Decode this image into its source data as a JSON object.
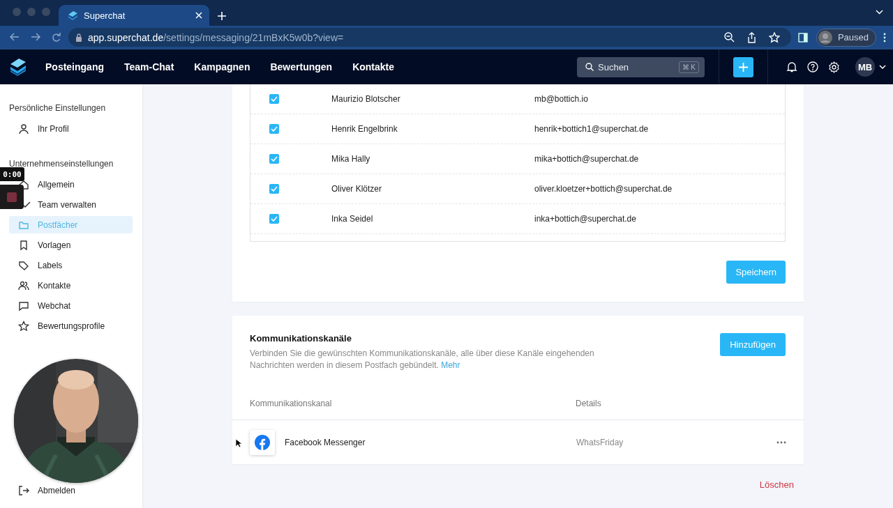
{
  "browser": {
    "tab_title": "Superchat",
    "url_host": "app.superchat.de",
    "url_path": "/settings/messaging/21mBxK5w0b?view=",
    "profile_status": "Paused"
  },
  "nav": {
    "items": [
      {
        "label": "Posteingang"
      },
      {
        "label": "Team-Chat"
      },
      {
        "label": "Kampagnen"
      },
      {
        "label": "Bewertungen"
      },
      {
        "label": "Kontakte"
      }
    ],
    "search": {
      "placeholder": "Suchen",
      "shortcut": "⌘ K"
    },
    "avatar": "MB"
  },
  "recording": {
    "time": "0:00"
  },
  "sidebar": {
    "sections": [
      {
        "title": "Persönliche Einstellungen",
        "items": [
          {
            "label": "Ihr Profil",
            "selected": false
          }
        ]
      },
      {
        "title": "Unternehmenseinstellungen",
        "items": [
          {
            "label": "Allgemein",
            "selected": false
          },
          {
            "label": "Team verwalten",
            "selected": false
          },
          {
            "label": "Postfächer",
            "selected": true
          },
          {
            "label": "Vorlagen",
            "selected": false
          },
          {
            "label": "Labels",
            "selected": false
          },
          {
            "label": "Kontakte",
            "selected": false
          },
          {
            "label": "Webchat",
            "selected": false
          },
          {
            "label": "Bewertungsprofile",
            "selected": false
          }
        ]
      }
    ],
    "logout": "Abmelden"
  },
  "members": {
    "rows": [
      {
        "name": "Maurizio Blotscher",
        "email": "mb@bottich.io",
        "checked": true
      },
      {
        "name": "Henrik Engelbrink",
        "email": "henrik+bottich1@superchat.de",
        "checked": true
      },
      {
        "name": "Mika Hally",
        "email": "mika+bottich@superchat.de",
        "checked": true
      },
      {
        "name": "Oliver Klötzer",
        "email": "oliver.kloetzer+bottich@superchat.de",
        "checked": true
      },
      {
        "name": "Inka Seidel",
        "email": "inka+bottich@superchat.de",
        "checked": true
      }
    ],
    "save_button": "Speichern"
  },
  "channels": {
    "title": "Kommunikationskanäle",
    "description": "Verbinden Sie die gewünschten Kommunikationskanäle, alle über diese Kanäle eingehenden Nachrichten werden in diesem Postfach gebündelt.",
    "more_link": "Mehr",
    "add_button": "Hinzufügen",
    "columns": [
      "Kommunikationskanal",
      "Details"
    ],
    "rows": [
      {
        "name": "Facebook Messenger",
        "details": "WhatsFriday"
      }
    ]
  },
  "delete_button": "Löschen"
}
